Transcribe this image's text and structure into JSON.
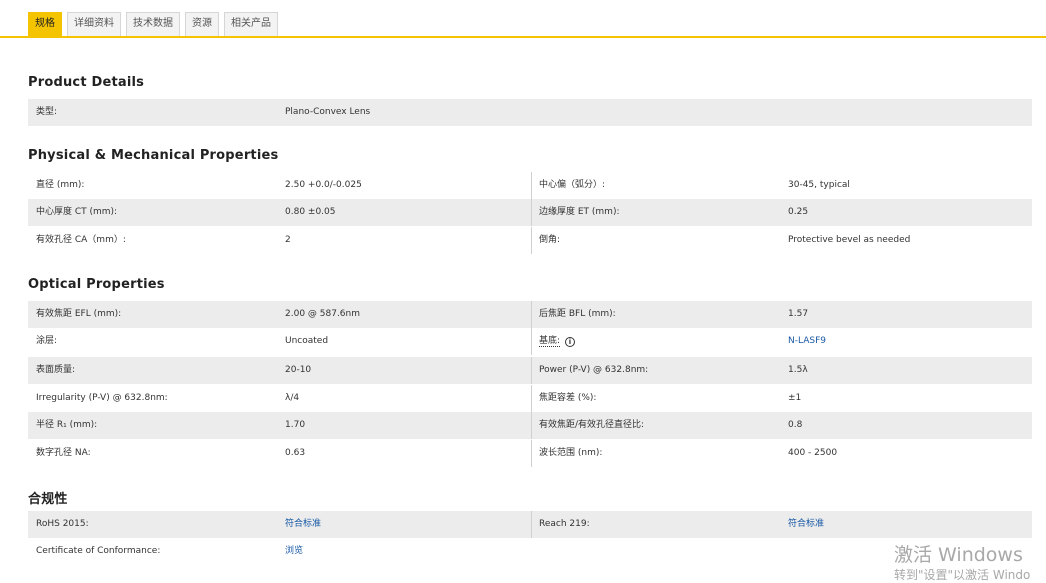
{
  "tabs": [
    "规格",
    "详细资料",
    "技术数据",
    "资源",
    "相关产品"
  ],
  "sections": {
    "product": "Product Details",
    "physical": "Physical & Mechanical Properties",
    "optical": "Optical Properties",
    "compliance": "合规性"
  },
  "product": {
    "type_label": "类型:",
    "type_value": "Plano-Convex Lens"
  },
  "physical": {
    "r0": [
      "直径 (mm):",
      "2.50 +0.0/-0.025",
      "中心偏（弧分）:",
      "30-45, typical"
    ],
    "r1": [
      "中心厚度 CT (mm):",
      "0.80 ±0.05",
      "边缘厚度 ET (mm):",
      "0.25"
    ],
    "r2": [
      "有效孔径 CA（mm）:",
      "2",
      "倒角:",
      "Protective bevel as needed"
    ]
  },
  "optical": {
    "r0": [
      "有效焦距 EFL (mm):",
      "2.00 @ 587.6nm",
      "后焦距 BFL (mm):",
      "1.57"
    ],
    "r1": [
      "涂层:",
      "Uncoated",
      "基底:",
      "N-LASF9"
    ],
    "r2": [
      "表面质量:",
      "20-10",
      "Power (P-V) @ 632.8nm:",
      "1.5λ"
    ],
    "r3": [
      "Irregularity (P-V) @ 632.8nm:",
      "λ/4",
      "焦距容差 (%):",
      "±1"
    ],
    "r4": [
      "半径 R₁ (mm):",
      "1.70",
      "有效焦距/有效孔径直径比:",
      "0.8"
    ],
    "r5": [
      "数字孔径 NA:",
      "0.63",
      "波长范围 (nm):",
      "400 - 2500"
    ]
  },
  "compliance": {
    "r0": [
      "RoHS 2015:",
      "符合标准",
      "Reach 219:",
      "符合标准"
    ],
    "r1": [
      "Certificate of Conformance:",
      "浏览"
    ]
  },
  "info_icon": "i",
  "watermark": {
    "line1": "激活 Windows",
    "line2": "转到\"设置\"以激活 Windo"
  }
}
